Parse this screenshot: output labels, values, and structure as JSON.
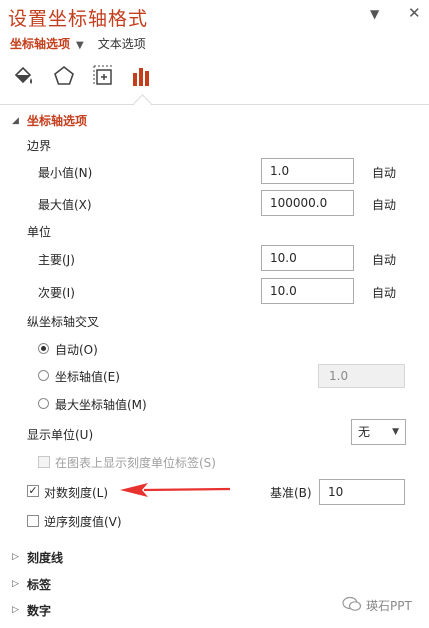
{
  "pane": {
    "title": "设置坐标轴格式",
    "dropdown_icon": "triangle-down",
    "close_icon": "close-x",
    "tabs": [
      {
        "label": "坐标轴选项",
        "active": true
      },
      {
        "label": "文本选项",
        "active": false
      }
    ],
    "icons": [
      "fill-bucket-icon",
      "pentagon-icon",
      "size-properties-icon",
      "bar-chart-icon"
    ],
    "accent_color": "#c43e1c"
  },
  "axis_options": {
    "header": "坐标轴选项",
    "bounds": {
      "label": "边界",
      "min": {
        "label": "最小值(N)",
        "value": "1.0",
        "auto": "自动"
      },
      "max": {
        "label": "最大值(X)",
        "value": "100000.0",
        "auto": "自动"
      }
    },
    "units": {
      "label": "单位",
      "major": {
        "label": "主要(J)",
        "value": "10.0",
        "auto": "自动"
      },
      "minor": {
        "label": "次要(I)",
        "value": "10.0",
        "auto": "自动"
      }
    },
    "cross": {
      "label": "纵坐标轴交叉",
      "options": [
        {
          "label": "自动(O)",
          "selected": true
        },
        {
          "label": "坐标轴值(E)",
          "selected": false,
          "value": "1.0"
        },
        {
          "label": "最大坐标轴值(M)",
          "selected": false
        }
      ]
    },
    "display_units": {
      "label": "显示单位(U)",
      "value": "无"
    },
    "show_label": {
      "label": "在图表上显示刻度单位标签(S)",
      "checked": false,
      "disabled": true
    },
    "log_scale": {
      "label": "对数刻度(L)",
      "checked": true,
      "base_label": "基准(B)",
      "base_value": "10"
    },
    "reverse": {
      "label": "逆序刻度值(V)",
      "checked": false
    }
  },
  "collapsed_sections": [
    "刻度线",
    "标签",
    "数字"
  ],
  "watermark": "瑛石PPT",
  "annotation_arrow_color": "#e8322f"
}
